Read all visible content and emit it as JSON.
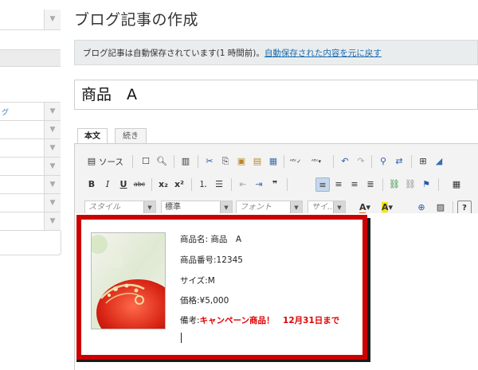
{
  "sidebar": {
    "rows": [
      {
        "text": "",
        "arrow": "▼"
      },
      {
        "text": "",
        "arrow": ""
      },
      {
        "text": "",
        "arrow": ""
      },
      {
        "text": "グ",
        "arrow": "▼"
      },
      {
        "text": "",
        "arrow": "▼"
      },
      {
        "text": "",
        "arrow": "▼"
      },
      {
        "text": "",
        "arrow": "▼"
      },
      {
        "text": "",
        "arrow": "▼"
      },
      {
        "text": "",
        "arrow": "▼"
      },
      {
        "text": "",
        "arrow": "▼"
      }
    ]
  },
  "page": {
    "title": "ブログ記事の作成",
    "notice_text": "ブログ記事は自動保存されています(1 時間前)。",
    "notice_link": "自動保存された内容を元に戻す",
    "post_title": "商品　A"
  },
  "tabs": [
    {
      "label": "本文",
      "active": true
    },
    {
      "label": "続き",
      "active": false
    }
  ],
  "toolbar": {
    "source_label": "ソース",
    "style_placeholder": "スタイル",
    "format_value": "標準",
    "font_placeholder": "フォント",
    "size_placeholder": "サイ..."
  },
  "content": {
    "product_name": "商品名:  商品　A",
    "product_number": "商品番号:12345",
    "size": "サイズ:M",
    "price": "価格:¥5,000",
    "remark_label": "備考:",
    "remark_value": "キャンペーン商品！　12月31日まで"
  },
  "colors": {
    "highlight_border": "#cc0000",
    "remark_text": "#e00000",
    "link": "#1b6cb0"
  }
}
